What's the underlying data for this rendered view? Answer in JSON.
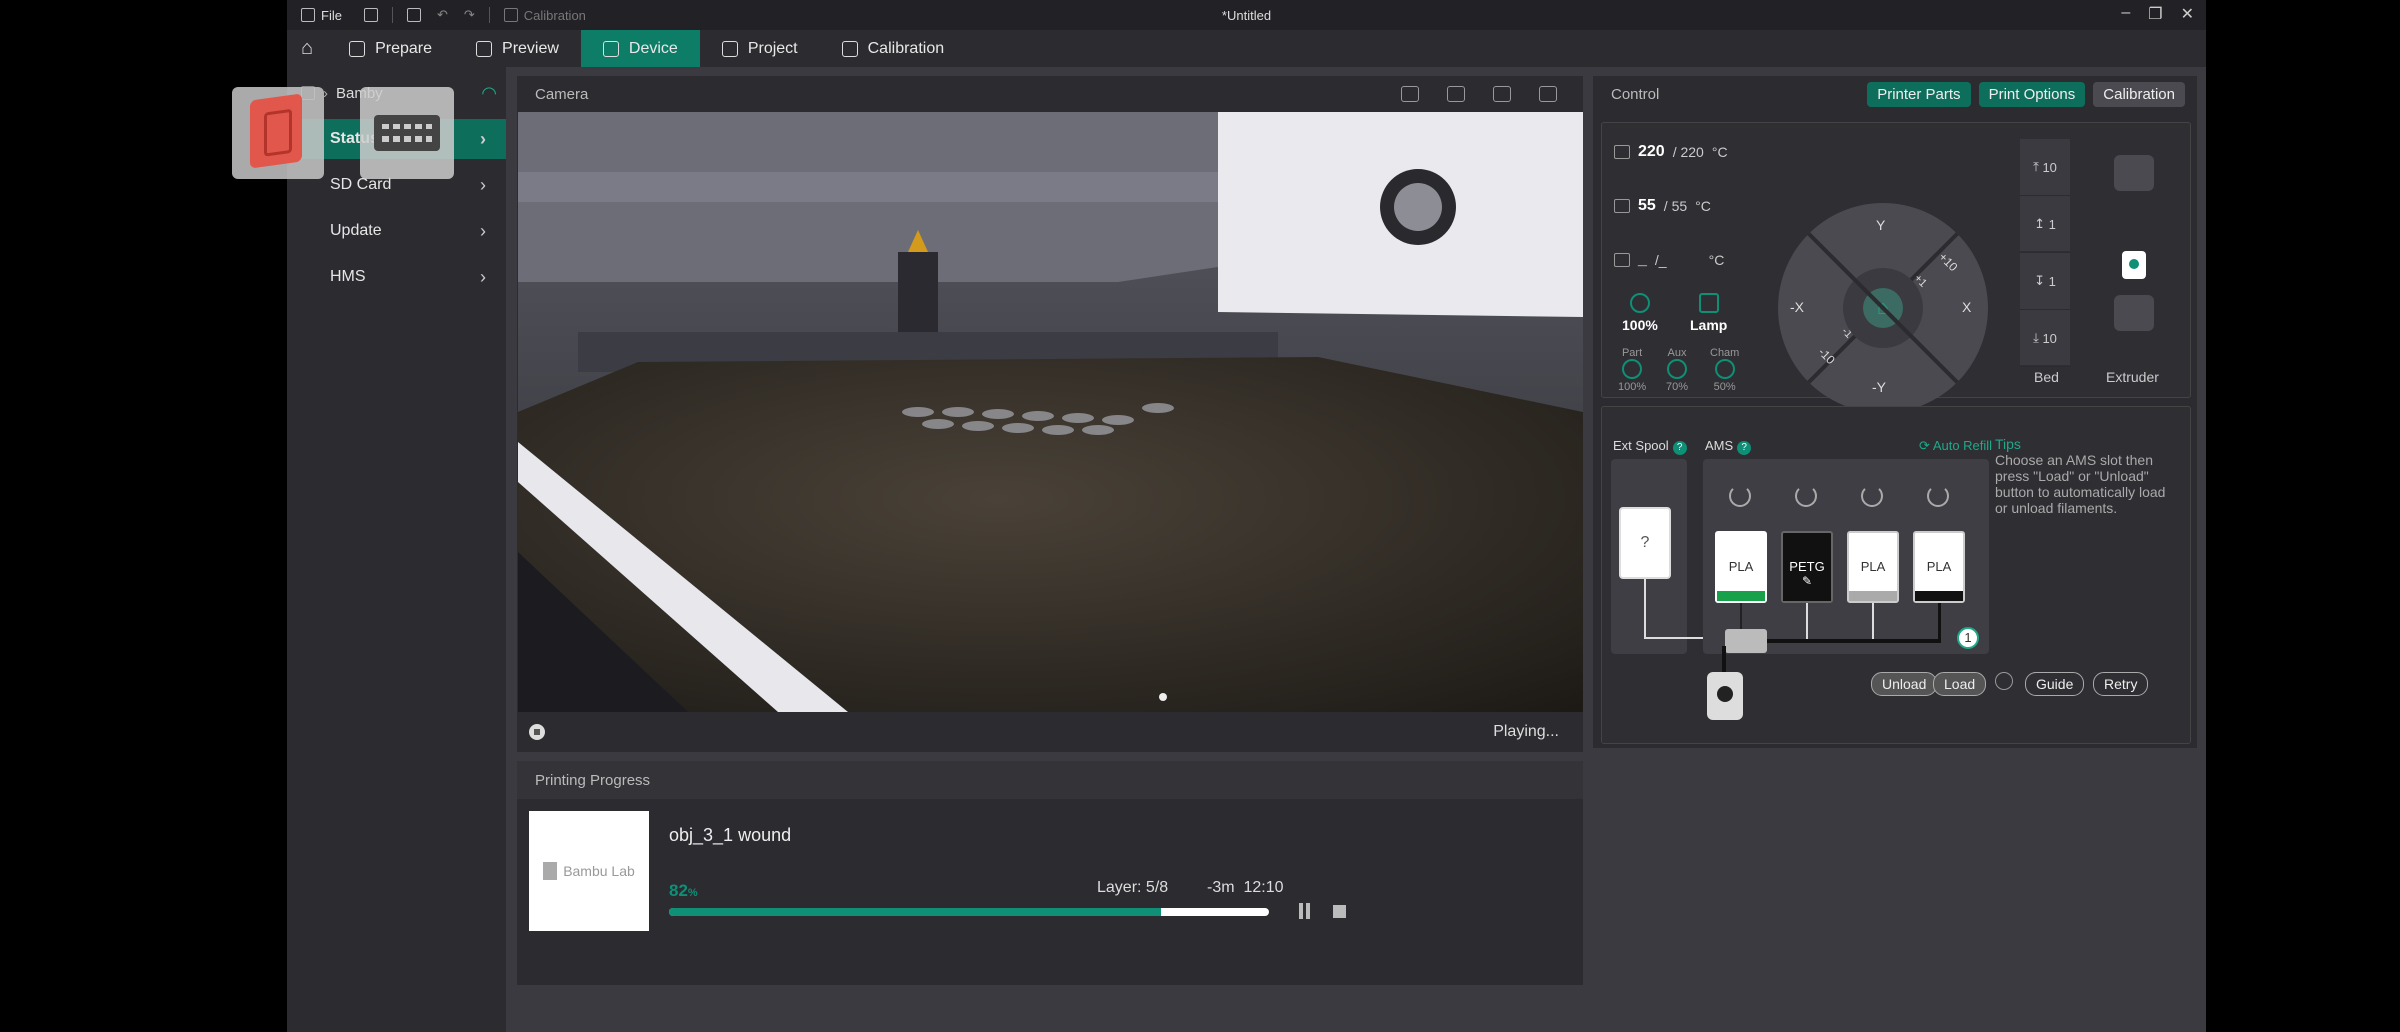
{
  "titlebar": {
    "file_label": "File",
    "calibration_label": "Calibration",
    "title": "*Untitled",
    "controls": [
      "–",
      "❐",
      "✕"
    ]
  },
  "tabs": [
    {
      "label": "Prepare"
    },
    {
      "label": "Preview"
    },
    {
      "label": "Device"
    },
    {
      "label": "Project"
    },
    {
      "label": "Calibration"
    }
  ],
  "sidebar": {
    "device_name": "Bamby",
    "items": [
      {
        "label": "Status"
      },
      {
        "label": "SD Card"
      },
      {
        "label": "Update"
      },
      {
        "label": "HMS"
      }
    ]
  },
  "camera": {
    "title": "Camera",
    "status": "Playing..."
  },
  "progress": {
    "title": "Printing Progress",
    "thumb_text": "Bambu Lab",
    "object_name": "obj_3_1 wound",
    "percent": 82,
    "percent_unit": "%",
    "layer": "Layer: 5/8",
    "eta": "-3m",
    "time": "12:10"
  },
  "control": {
    "title": "Control",
    "buttons": [
      "Printer Parts",
      "Print Options",
      "Calibration"
    ],
    "nozzle": {
      "current": "220",
      "target": "/ 220",
      "unit": "°C"
    },
    "bed": {
      "current": "55",
      "target": "/ 55",
      "unit": "°C"
    },
    "chamber": {
      "current": "_",
      "target": "/_",
      "unit": "°C"
    },
    "speed": {
      "value": "100%",
      "lamp": "Lamp"
    },
    "fans": [
      {
        "label": "Part",
        "value": "100%"
      },
      {
        "label": "Aux",
        "value": "70%"
      },
      {
        "label": "Cham",
        "value": "50%"
      }
    ],
    "joystick": {
      "y": "Y",
      "ny": "-Y",
      "x": "X",
      "nx": "-X",
      "p10": "+10",
      "p1": "+1",
      "m1": "-1",
      "m10": "-10"
    },
    "bed_steps": [
      "10",
      "1",
      "1",
      "10"
    ],
    "bed_label": "Bed",
    "extruder_label": "Extruder"
  },
  "ams": {
    "ext_spool_label": "Ext Spool",
    "ams_label": "AMS",
    "auto_refill": "Auto Refill",
    "ext_slot": "?",
    "slots": [
      {
        "material": "PLA",
        "bg": "#ffffff",
        "fg": "#333333",
        "stripe": "#19a04a"
      },
      {
        "material": "PETG",
        "bg": "#111111",
        "fg": "#ffffff",
        "stripe": "#111111"
      },
      {
        "material": "PLA",
        "bg": "#ffffff",
        "fg": "#333333",
        "stripe": "#aaaaaa"
      },
      {
        "material": "PLA",
        "bg": "#ffffff",
        "fg": "#333333",
        "stripe": "#111111"
      }
    ],
    "slot_index": "1",
    "tips_title": "Tips",
    "tips_body": "Choose an AMS slot then press \"Load\" or \"Unload\" button to automatically load or unload filaments.",
    "buttons": {
      "unload": "Unload",
      "load": "Load",
      "guide": "Guide",
      "retry": "Retry"
    }
  }
}
